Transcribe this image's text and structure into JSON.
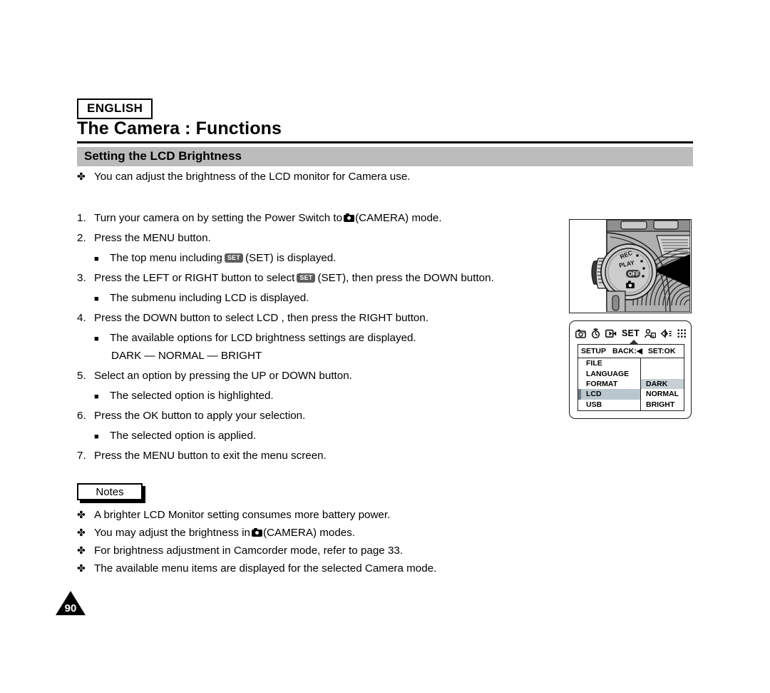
{
  "header": {
    "language_badge": "ENGLISH",
    "title": "The Camera : Functions",
    "section_title": "Setting the LCD Brightness"
  },
  "intro": {
    "bullet": "✤",
    "text": "You can adjust the brightness of the LCD monitor for Camera use."
  },
  "steps": [
    {
      "num": "1.",
      "pre": "Turn your camera on by setting the Power Switch to",
      "icon": "camera-icon",
      "post": "(CAMERA) mode."
    },
    {
      "num": "2.",
      "pre": "Press the MENU button.",
      "post": ""
    },
    {
      "num": "3.",
      "pre": "Press the LEFT or RIGHT button to select",
      "icon": "set-badge-icon",
      "post": "(SET), then press the DOWN button."
    },
    {
      "num": "4.",
      "pre": "Press the DOWN button to select  LCD , then press the RIGHT button.",
      "post": ""
    },
    {
      "num": "5.",
      "pre": "Select an option by pressing the UP or DOWN button.",
      "post": ""
    },
    {
      "num": "6.",
      "pre": "Press the OK button to apply your selection.",
      "post": ""
    },
    {
      "num": "7.",
      "pre": "Press the MENU button to exit the menu screen.",
      "post": ""
    }
  ],
  "sub_bullets": {
    "marker": "■",
    "top_menu_pre": "The top menu including",
    "top_menu_post": "(SET) is displayed.",
    "submenu": "The submenu including  LCD  is displayed.",
    "options_displayed": "The available options for LCD brightness settings are displayed.",
    "options_list": "DARK — NORMAL — BRIGHT",
    "highlighted": "The selected option is highlighted.",
    "applied": "The selected option is applied."
  },
  "notes": {
    "label": "Notes",
    "bullet": "✤",
    "items": [
      {
        "pre": "A brighter LCD Monitor setting consumes more battery power.",
        "post": ""
      },
      {
        "pre": "You may adjust the brightness in",
        "icon": "camera-icon",
        "post": "(CAMERA) modes."
      },
      {
        "pre": "For brightness adjustment in Camcorder mode, refer to page 33.",
        "post": ""
      },
      {
        "pre": "The available menu items are displayed for the selected Camera mode.",
        "post": ""
      }
    ]
  },
  "page_number": "90",
  "figures": {
    "camera_photo": {
      "name": "camera-power-switch-photo",
      "dial_labels": [
        "REC",
        "PLAY",
        "OFF"
      ],
      "dial_mode_icon": "camera-icon"
    },
    "lcd_menu": {
      "name": "lcd-setup-menu-figure",
      "icon_row": [
        "camera-icon",
        "self-timer-icon",
        "back-light-icon",
        "set-icon",
        "portrait-icon",
        "sound-icon",
        "mosaic-grid-icon"
      ],
      "set_label": "SET",
      "head": {
        "left": "SETUP",
        "middle": "BACK:",
        "middle_arrow": "◀",
        "right": "SET:OK"
      },
      "left_items": [
        "FILE",
        "LANGUAGE",
        "FORMAT",
        "LCD",
        "USB"
      ],
      "left_selected": "LCD",
      "right_items": [
        "DARK",
        "NORMAL",
        "BRIGHT"
      ],
      "right_selected": "DARK"
    }
  },
  "colors": {
    "section_bar": "#bcbcbc",
    "menu_highlight": "#b9c6ce",
    "option_highlight": "#c5cfd4",
    "set_badge": "#5e5e5e"
  }
}
